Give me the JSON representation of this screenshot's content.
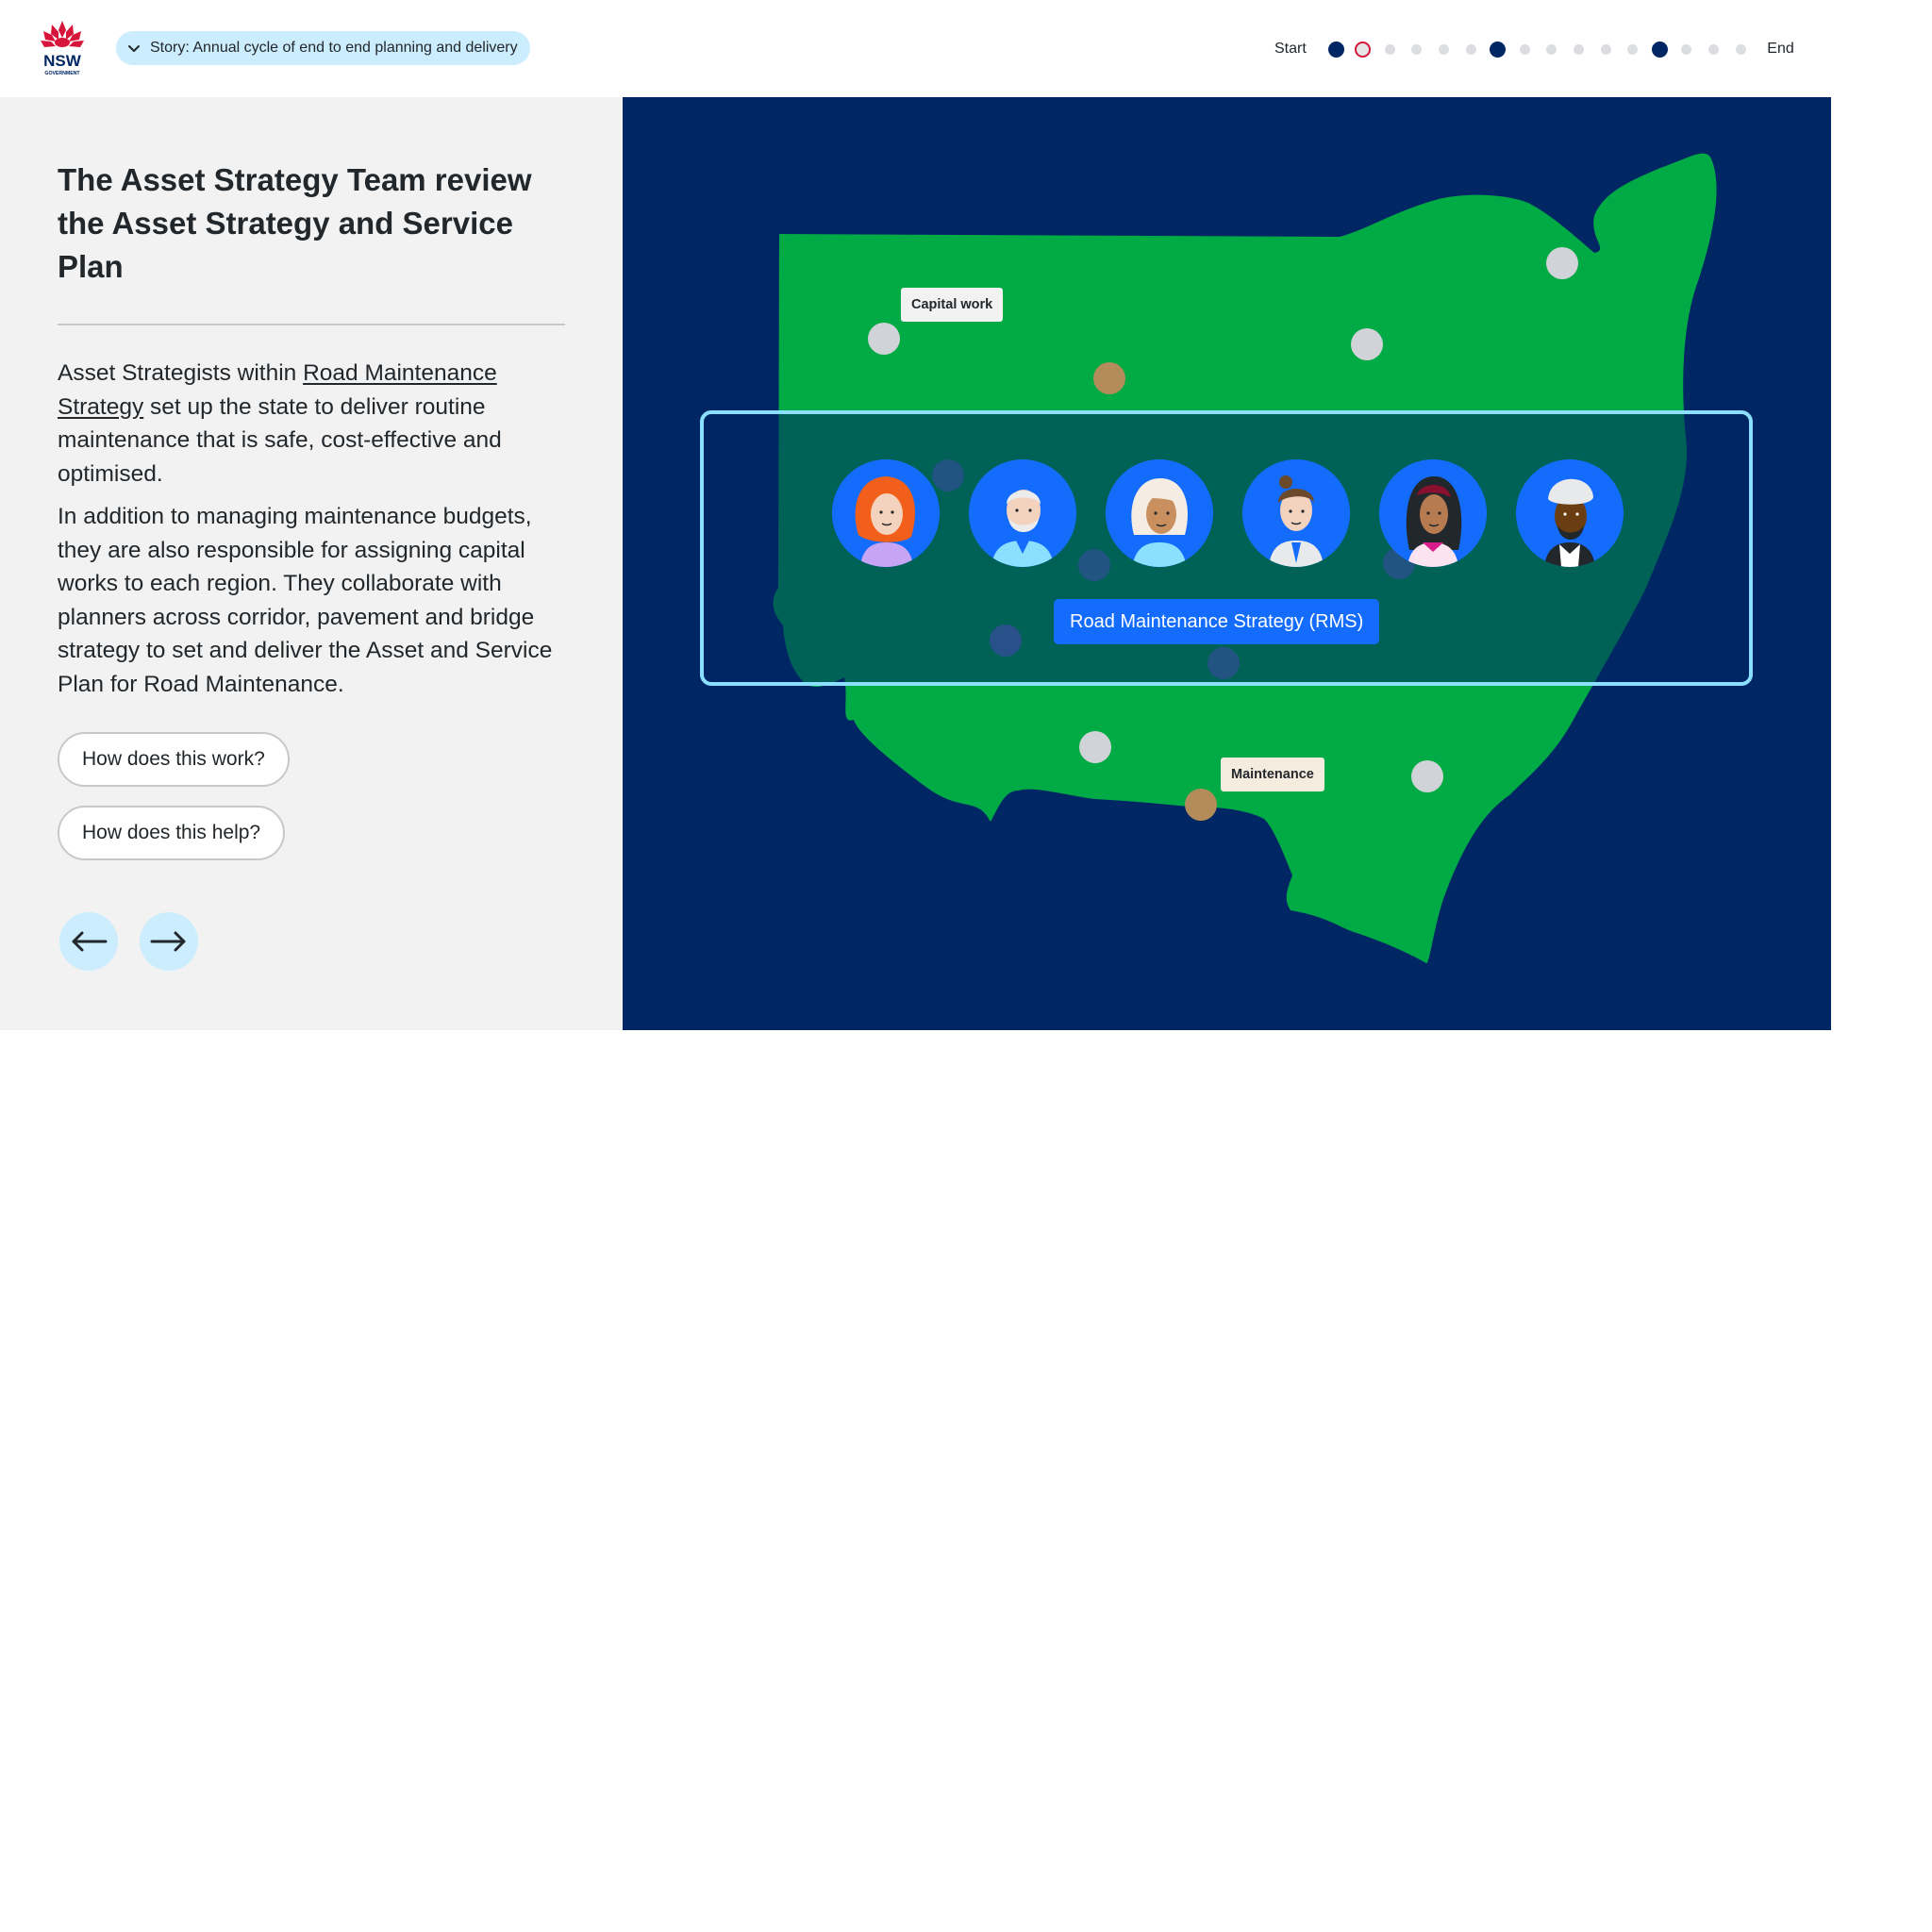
{
  "header": {
    "logo_text": "NSW",
    "logo_subtext": "GOVERNMENT",
    "story_label": "Story: Annual cycle of end to end planning and delivery",
    "progress": {
      "start_label": "Start",
      "end_label": "End",
      "current_step": 2,
      "steps": [
        "filled",
        "current",
        "empty",
        "empty",
        "empty",
        "empty",
        "filled",
        "empty",
        "empty",
        "empty",
        "empty",
        "empty",
        "filled",
        "empty",
        "empty",
        "empty"
      ]
    }
  },
  "content": {
    "title": "The Asset Strategy Team review the Asset Strategy and Service Plan",
    "para1_before": "Asset Strategists within ",
    "para1_link": "Road Maintenance Strategy",
    "para1_after": " set up the state to deliver routine maintenance that is safe, cost-effective and optimised.",
    "para2": "In addition to managing maintenance budgets, they are also responsible for assigning capital works to each region. They collaborate with planners across corridor, pavement and bridge strategy to set and deliver the Asset and Service Plan for Road Maintenance.",
    "questions": [
      "How does this work?",
      "How does this help?"
    ]
  },
  "map": {
    "label_capital": "Capital work",
    "label_maintenance": "Maintenance",
    "team_label": "Road Maintenance Strategy (RMS)",
    "colors": {
      "background": "#002664",
      "land": "#00aa45",
      "marker_grey": "#d0d3d7",
      "marker_tan": "#b38c5a",
      "box_border": "#8ce0ff",
      "team_label_bg": "#146cfd"
    }
  },
  "colors": {
    "brand_navy": "#002664",
    "accent_red": "#d7153a",
    "pill_bg": "#cbedfd",
    "panel_bg": "#f2f2f2"
  }
}
